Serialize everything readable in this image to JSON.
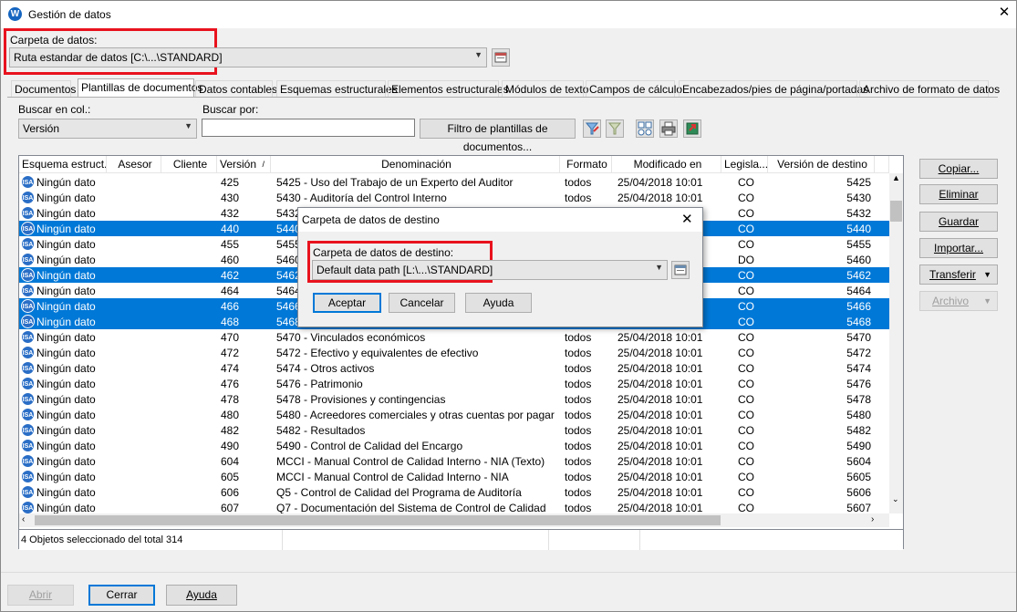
{
  "window": {
    "title": "Gestión de datos",
    "app_icon": "W"
  },
  "folder": {
    "label": "Carpeta de datos:",
    "value": "Ruta estandar de datos [C:\\...\\STANDARD]"
  },
  "tabs": [
    {
      "label": "Documentos"
    },
    {
      "label": "Plantillas de documentos"
    },
    {
      "label": "Datos contables"
    },
    {
      "label": "Esquemas estructurales"
    },
    {
      "label": "Elementos estructurales"
    },
    {
      "label": "Módulos de texto"
    },
    {
      "label": "Campos de cálculo"
    },
    {
      "label": "Encabezados/pies de página/portadas"
    },
    {
      "label": "Archivo de formato de datos"
    }
  ],
  "search": {
    "col_label": "Buscar en col.:",
    "col_value": "Versión",
    "by_label": "Buscar por:",
    "by_value": "",
    "filter_button": "Filtro de plantillas de documentos..."
  },
  "table": {
    "columns": [
      "Esquema estruct...",
      "Asesor",
      "Cliente",
      "Versión",
      "Denominación",
      "Formato",
      "Modificado en",
      "Legisla...",
      "Versión de destino"
    ],
    "rows": [
      {
        "esquema": "Ningún dato",
        "version": "425",
        "denominacion": "5425 - Uso del Trabajo de un Experto del Auditor",
        "formato": "todos",
        "modificado": "25/04/2018 10:01",
        "legis": "CO",
        "destino": "5425",
        "selected": false
      },
      {
        "esquema": "Ningún dato",
        "version": "430",
        "denominacion": "5430 - Auditoría del Control Interno",
        "formato": "todos",
        "modificado": "25/04/2018 10:01",
        "legis": "CO",
        "destino": "5430",
        "selected": false
      },
      {
        "esquema": "Ningún dato",
        "version": "432",
        "denominacion": "5432",
        "formato": "",
        "modificado": "",
        "legis": "CO",
        "destino": "5432",
        "selected": false
      },
      {
        "esquema": "Ningún dato",
        "version": "440",
        "denominacion": "5440",
        "formato": "",
        "modificado": "",
        "legis": "CO",
        "destino": "5440",
        "selected": true
      },
      {
        "esquema": "Ningún dato",
        "version": "455",
        "denominacion": "5455",
        "formato": "",
        "modificado": "",
        "legis": "CO",
        "destino": "5455",
        "selected": false
      },
      {
        "esquema": "Ningún dato",
        "version": "460",
        "denominacion": "5460",
        "formato": "",
        "modificado": "",
        "legis": "DO",
        "destino": "5460",
        "selected": false
      },
      {
        "esquema": "Ningún dato",
        "version": "462",
        "denominacion": "5462",
        "formato": "",
        "modificado": "",
        "legis": "CO",
        "destino": "5462",
        "selected": true
      },
      {
        "esquema": "Ningún dato",
        "version": "464",
        "denominacion": "5464",
        "formato": "",
        "modificado": "",
        "legis": "CO",
        "destino": "5464",
        "selected": false
      },
      {
        "esquema": "Ningún dato",
        "version": "466",
        "denominacion": "5466",
        "formato": "",
        "modificado": "",
        "legis": "CO",
        "destino": "5466",
        "selected": true
      },
      {
        "esquema": "Ningún dato",
        "version": "468",
        "denominacion": "5468",
        "formato": "",
        "modificado": "",
        "legis": "CO",
        "destino": "5468",
        "selected": true
      },
      {
        "esquema": "Ningún dato",
        "version": "470",
        "denominacion": "5470 - Vinculados económicos",
        "formato": "todos",
        "modificado": "25/04/2018 10:01",
        "legis": "CO",
        "destino": "5470",
        "selected": false
      },
      {
        "esquema": "Ningún dato",
        "version": "472",
        "denominacion": "5472 - Efectivo y equivalentes de efectivo",
        "formato": "todos",
        "modificado": "25/04/2018 10:01",
        "legis": "CO",
        "destino": "5472",
        "selected": false
      },
      {
        "esquema": "Ningún dato",
        "version": "474",
        "denominacion": "5474 - Otros activos",
        "formato": "todos",
        "modificado": "25/04/2018 10:01",
        "legis": "CO",
        "destino": "5474",
        "selected": false
      },
      {
        "esquema": "Ningún dato",
        "version": "476",
        "denominacion": "5476 - Patrimonio",
        "formato": "todos",
        "modificado": "25/04/2018 10:01",
        "legis": "CO",
        "destino": "5476",
        "selected": false
      },
      {
        "esquema": "Ningún dato",
        "version": "478",
        "denominacion": "5478 - Provisiones y contingencias",
        "formato": "todos",
        "modificado": "25/04/2018 10:01",
        "legis": "CO",
        "destino": "5478",
        "selected": false
      },
      {
        "esquema": "Ningún dato",
        "version": "480",
        "denominacion": "5480 - Acreedores comerciales y otras cuentas por pagar",
        "formato": "todos",
        "modificado": "25/04/2018 10:01",
        "legis": "CO",
        "destino": "5480",
        "selected": false
      },
      {
        "esquema": "Ningún dato",
        "version": "482",
        "denominacion": "5482 - Resultados",
        "formato": "todos",
        "modificado": "25/04/2018 10:01",
        "legis": "CO",
        "destino": "5482",
        "selected": false
      },
      {
        "esquema": "Ningún dato",
        "version": "490",
        "denominacion": "5490 - Control de Calidad del Encargo",
        "formato": "todos",
        "modificado": "25/04/2018 10:01",
        "legis": "CO",
        "destino": "5490",
        "selected": false
      },
      {
        "esquema": "Ningún dato",
        "version": "604",
        "denominacion": "MCCI - Manual Control de Calidad Interno - NIA (Texto)",
        "formato": "todos",
        "modificado": "25/04/2018 10:01",
        "legis": "CO",
        "destino": "5604",
        "selected": false
      },
      {
        "esquema": "Ningún dato",
        "version": "605",
        "denominacion": "MCCI - Manual Control de Calidad Interno - NIA",
        "formato": "todos",
        "modificado": "25/04/2018 10:01",
        "legis": "CO",
        "destino": "5605",
        "selected": false
      },
      {
        "esquema": "Ningún dato",
        "version": "606",
        "denominacion": "Q5 - Control de Calidad del Programa de Auditoría",
        "formato": "todos",
        "modificado": "25/04/2018 10:01",
        "legis": "CO",
        "destino": "5606",
        "selected": false
      },
      {
        "esquema": "Ningún dato",
        "version": "607",
        "denominacion": "Q7 - Documentación del Sistema de Control de Calidad",
        "formato": "todos",
        "modificado": "25/04/2018 10:01",
        "legis": "CO",
        "destino": "5607",
        "selected": false
      }
    ]
  },
  "status": {
    "text": "4 Objetos  seleccionado del total 314"
  },
  "side_buttons": {
    "copy": "Copiar...",
    "delete": "Eliminar",
    "save": "Guardar",
    "import": "Importar...",
    "transfer": "Transferir",
    "archive": "Archivo"
  },
  "bottom_buttons": {
    "open": "Abrir",
    "close": "Cerrar",
    "help": "Ayuda"
  },
  "dialog": {
    "title": "Carpeta de datos de destino",
    "label": "Carpeta de datos de destino:",
    "value": "Default data path [L:\\...\\STANDARD]",
    "ok": "Aceptar",
    "cancel": "Cancelar",
    "help": "Ayuda"
  },
  "icons": [
    "app-icon",
    "close-icon",
    "folder-browse-icon",
    "filter-icon",
    "filter-off-icon",
    "view-icon",
    "print-icon",
    "export-icon",
    "isa-icon",
    "sort-icon",
    "chevron-down-icon",
    "scroll-up-icon",
    "scroll-down-icon",
    "scroll-left-icon",
    "scroll-right-icon"
  ],
  "colors": {
    "selection": "#0078d7",
    "highlight_box": "#e8121e",
    "app_icon": "#1565c0"
  }
}
